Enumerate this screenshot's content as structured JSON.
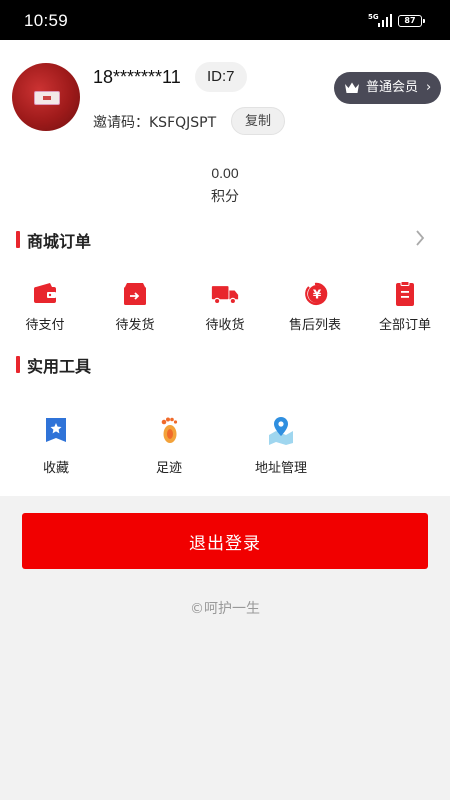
{
  "status_bar": {
    "time": "10:59",
    "network": "5G",
    "battery": "87"
  },
  "profile": {
    "phone": "18*******11",
    "id_badge": "ID:7",
    "invite_code": "邀请码：KSFQJSPT",
    "copy_label": "复制",
    "membership": "普通会员"
  },
  "points": {
    "value": "0.00",
    "label": "积分"
  },
  "orders": {
    "title": "商城订单",
    "items": [
      {
        "label": "待支付",
        "icon": "wallet-icon"
      },
      {
        "label": "待发货",
        "icon": "box-arrow-icon"
      },
      {
        "label": "待收货",
        "icon": "truck-icon"
      },
      {
        "label": "售后列表",
        "icon": "yen-refund-icon"
      },
      {
        "label": "全部订单",
        "icon": "clipboard-icon"
      }
    ]
  },
  "tools": {
    "title": "实用工具",
    "items": [
      {
        "label": "收藏",
        "icon": "star-bookmark-icon"
      },
      {
        "label": "足迹",
        "icon": "footprint-icon"
      },
      {
        "label": "地址管理",
        "icon": "map-pin-icon"
      }
    ]
  },
  "logout_label": "退出登录",
  "footer": "©呵护一生",
  "colors": {
    "accent": "#e8262d",
    "logout": "#f10000",
    "member_badge": "#4a4a57"
  }
}
